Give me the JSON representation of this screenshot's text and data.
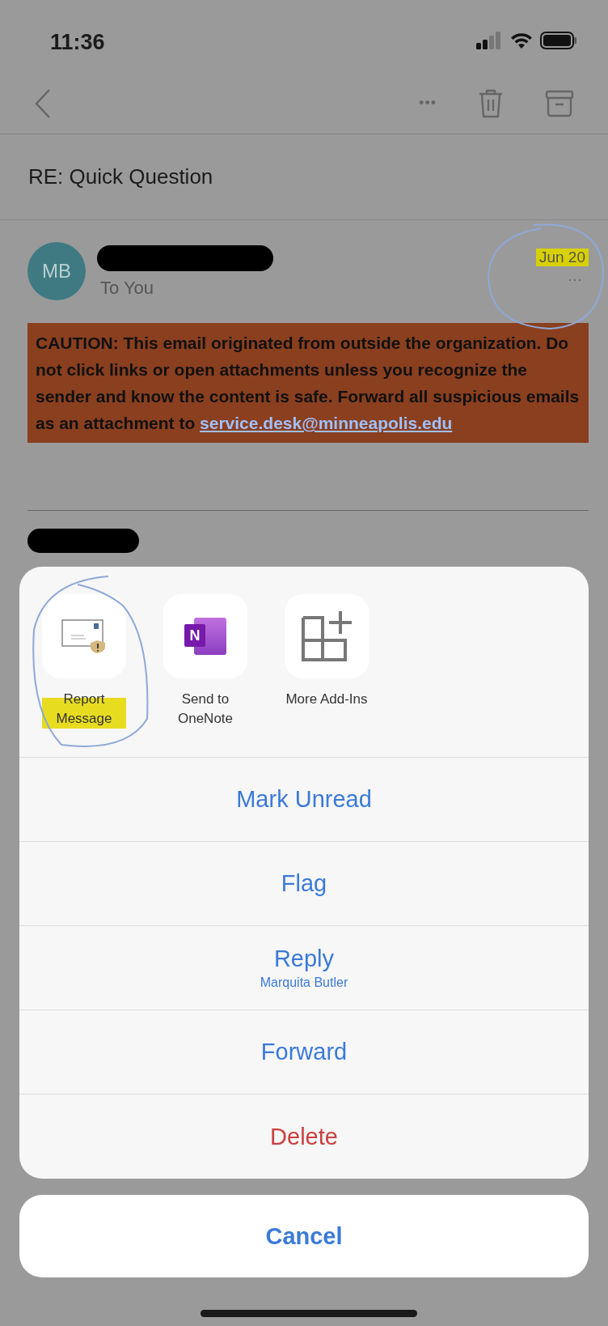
{
  "status_bar": {
    "time": "11:36"
  },
  "nav": {
    "more": "•••"
  },
  "subject": "RE: Quick Question",
  "message": {
    "avatar": "MB",
    "sender_redacted": true,
    "recipient": "To You",
    "date": "Jun 20",
    "more": "···",
    "caution": "CAUTION: This email originated from outside the organization. Do not click links or open attachments unless you recognize the sender and know the content is safe. Forward all suspicious emails as an attachment to ",
    "caution_link": "service.desk@minneapolis.edu",
    "body_redacted": true
  },
  "add_ins": [
    {
      "kind": "report",
      "label": "Report Message"
    },
    {
      "kind": "onenote",
      "label": "Send to OneNote",
      "glyph": "N"
    },
    {
      "kind": "more",
      "label": "More Add-Ins"
    }
  ],
  "actions": [
    {
      "kind": "default",
      "label": "Mark Unread"
    },
    {
      "kind": "default",
      "label": "Flag"
    },
    {
      "kind": "default",
      "label": "Reply",
      "subtitle": "Marquita Butler"
    },
    {
      "kind": "default",
      "label": "Forward"
    },
    {
      "kind": "destructive",
      "label": "Delete"
    }
  ],
  "cancel": "Cancel"
}
